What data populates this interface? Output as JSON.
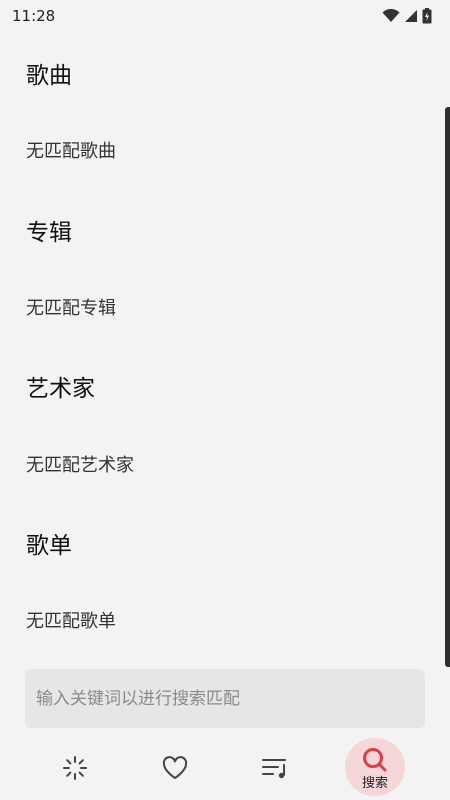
{
  "status_bar": {
    "time": "11:28"
  },
  "sections": [
    {
      "title": "歌曲",
      "empty_text": "无匹配歌曲"
    },
    {
      "title": "专辑",
      "empty_text": "无匹配专辑"
    },
    {
      "title": "艺术家",
      "empty_text": "无匹配艺术家"
    },
    {
      "title": "歌单",
      "empty_text": "无匹配歌单"
    }
  ],
  "search": {
    "placeholder": "输入关键词以进行搜索匹配",
    "value": ""
  },
  "bottom_nav": {
    "items": [
      {
        "icon": "loading-icon",
        "label": ""
      },
      {
        "icon": "heart-icon",
        "label": ""
      },
      {
        "icon": "playlist-icon",
        "label": ""
      },
      {
        "icon": "search-icon",
        "label": "搜索",
        "active": true
      }
    ],
    "active_color": "#e23b43",
    "active_bg": "#f6d7d8"
  }
}
